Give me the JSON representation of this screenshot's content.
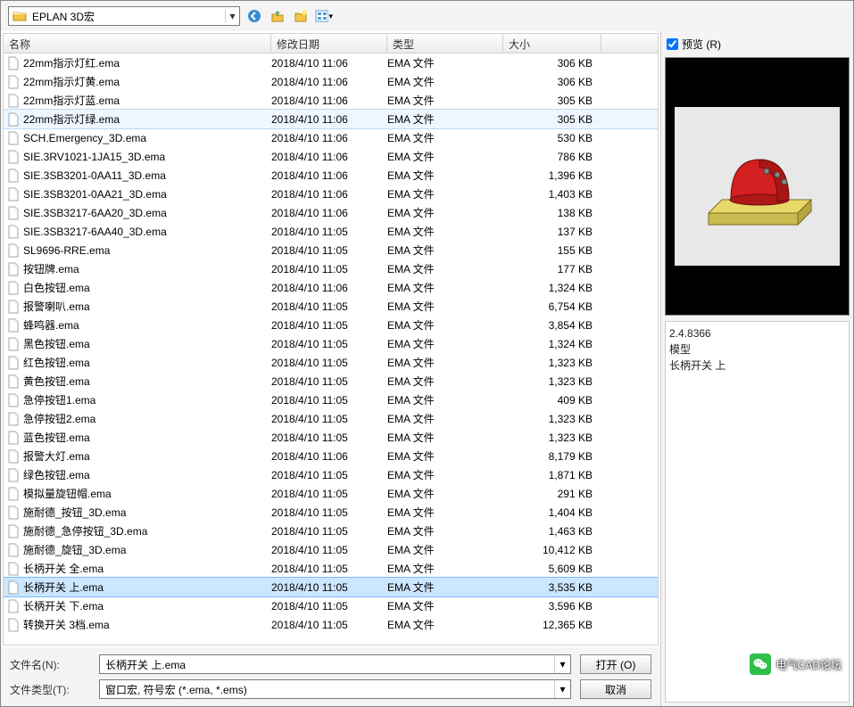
{
  "toolbar": {
    "folder_label": "EPLAN 3D宏"
  },
  "preview": {
    "checkbox_label": "预览 (R)",
    "checked": true
  },
  "columns": {
    "name": "名称",
    "date": "修改日期",
    "type": "类型",
    "size": "大小"
  },
  "files": [
    {
      "name": "22mm指示灯红.ema",
      "date": "2018/4/10 11:06",
      "type": "EMA 文件",
      "size": "306 KB"
    },
    {
      "name": "22mm指示灯黄.ema",
      "date": "2018/4/10 11:06",
      "type": "EMA 文件",
      "size": "306 KB"
    },
    {
      "name": "22mm指示灯蓝.ema",
      "date": "2018/4/10 11:06",
      "type": "EMA 文件",
      "size": "305 KB"
    },
    {
      "name": "22mm指示灯绿.ema",
      "date": "2018/4/10 11:06",
      "type": "EMA 文件",
      "size": "305 KB"
    },
    {
      "name": "SCH.Emergency_3D.ema",
      "date": "2018/4/10 11:06",
      "type": "EMA 文件",
      "size": "530 KB"
    },
    {
      "name": "SIE.3RV1021-1JA15_3D.ema",
      "date": "2018/4/10 11:06",
      "type": "EMA 文件",
      "size": "786 KB"
    },
    {
      "name": "SIE.3SB3201-0AA11_3D.ema",
      "date": "2018/4/10 11:06",
      "type": "EMA 文件",
      "size": "1,396 KB"
    },
    {
      "name": "SIE.3SB3201-0AA21_3D.ema",
      "date": "2018/4/10 11:06",
      "type": "EMA 文件",
      "size": "1,403 KB"
    },
    {
      "name": "SIE.3SB3217-6AA20_3D.ema",
      "date": "2018/4/10 11:06",
      "type": "EMA 文件",
      "size": "138 KB"
    },
    {
      "name": "SIE.3SB3217-6AA40_3D.ema",
      "date": "2018/4/10 11:05",
      "type": "EMA 文件",
      "size": "137 KB"
    },
    {
      "name": "SL9696-RRE.ema",
      "date": "2018/4/10 11:05",
      "type": "EMA 文件",
      "size": "155 KB"
    },
    {
      "name": "按钮牌.ema",
      "date": "2018/4/10 11:05",
      "type": "EMA 文件",
      "size": "177 KB"
    },
    {
      "name": "白色按钮.ema",
      "date": "2018/4/10 11:06",
      "type": "EMA 文件",
      "size": "1,324 KB"
    },
    {
      "name": "报警喇叭.ema",
      "date": "2018/4/10 11:05",
      "type": "EMA 文件",
      "size": "6,754 KB"
    },
    {
      "name": "蜂鸣器.ema",
      "date": "2018/4/10 11:05",
      "type": "EMA 文件",
      "size": "3,854 KB"
    },
    {
      "name": "黑色按钮.ema",
      "date": "2018/4/10 11:05",
      "type": "EMA 文件",
      "size": "1,324 KB"
    },
    {
      "name": "红色按钮.ema",
      "date": "2018/4/10 11:05",
      "type": "EMA 文件",
      "size": "1,323 KB"
    },
    {
      "name": "黄色按钮.ema",
      "date": "2018/4/10 11:05",
      "type": "EMA 文件",
      "size": "1,323 KB"
    },
    {
      "name": "急停按钮1.ema",
      "date": "2018/4/10 11:05",
      "type": "EMA 文件",
      "size": "409 KB"
    },
    {
      "name": "急停按钮2.ema",
      "date": "2018/4/10 11:05",
      "type": "EMA 文件",
      "size": "1,323 KB"
    },
    {
      "name": "蓝色按钮.ema",
      "date": "2018/4/10 11:05",
      "type": "EMA 文件",
      "size": "1,323 KB"
    },
    {
      "name": "报警大灯.ema",
      "date": "2018/4/10 11:06",
      "type": "EMA 文件",
      "size": "8,179 KB"
    },
    {
      "name": "绿色按钮.ema",
      "date": "2018/4/10 11:05",
      "type": "EMA 文件",
      "size": "1,871 KB"
    },
    {
      "name": "模拟量旋钮帽.ema",
      "date": "2018/4/10 11:05",
      "type": "EMA 文件",
      "size": "291 KB"
    },
    {
      "name": "施耐德_按钮_3D.ema",
      "date": "2018/4/10 11:05",
      "type": "EMA 文件",
      "size": "1,404 KB"
    },
    {
      "name": "施耐德_急停按钮_3D.ema",
      "date": "2018/4/10 11:05",
      "type": "EMA 文件",
      "size": "1,463 KB"
    },
    {
      "name": "施耐德_旋钮_3D.ema",
      "date": "2018/4/10 11:05",
      "type": "EMA 文件",
      "size": "10,412 KB"
    },
    {
      "name": "长柄开关 全.ema",
      "date": "2018/4/10 11:05",
      "type": "EMA 文件",
      "size": "5,609 KB"
    },
    {
      "name": "长柄开关 上.ema",
      "date": "2018/4/10 11:05",
      "type": "EMA 文件",
      "size": "3,535 KB"
    },
    {
      "name": "长柄开关 下.ema",
      "date": "2018/4/10 11:05",
      "type": "EMA 文件",
      "size": "3,596 KB"
    },
    {
      "name": "转换开关 3档.ema",
      "date": "2018/4/10 11:05",
      "type": "EMA 文件",
      "size": "12,365 KB"
    }
  ],
  "selected_index": 28,
  "hover_index": 3,
  "bottom": {
    "filename_label": "文件名(N):",
    "filetype_label": "文件类型(T):",
    "filename_value": "长柄开关 上.ema",
    "filetype_value": "窗口宏, 符号宏 (*.ema, *.ems)",
    "open_label": "打开 (O)",
    "cancel_label": "取消"
  },
  "info": {
    "line1": "2.4.8366",
    "line2": "模型",
    "line3": "长柄开关 上"
  },
  "watermark": {
    "text": "电气CAD论坛"
  }
}
